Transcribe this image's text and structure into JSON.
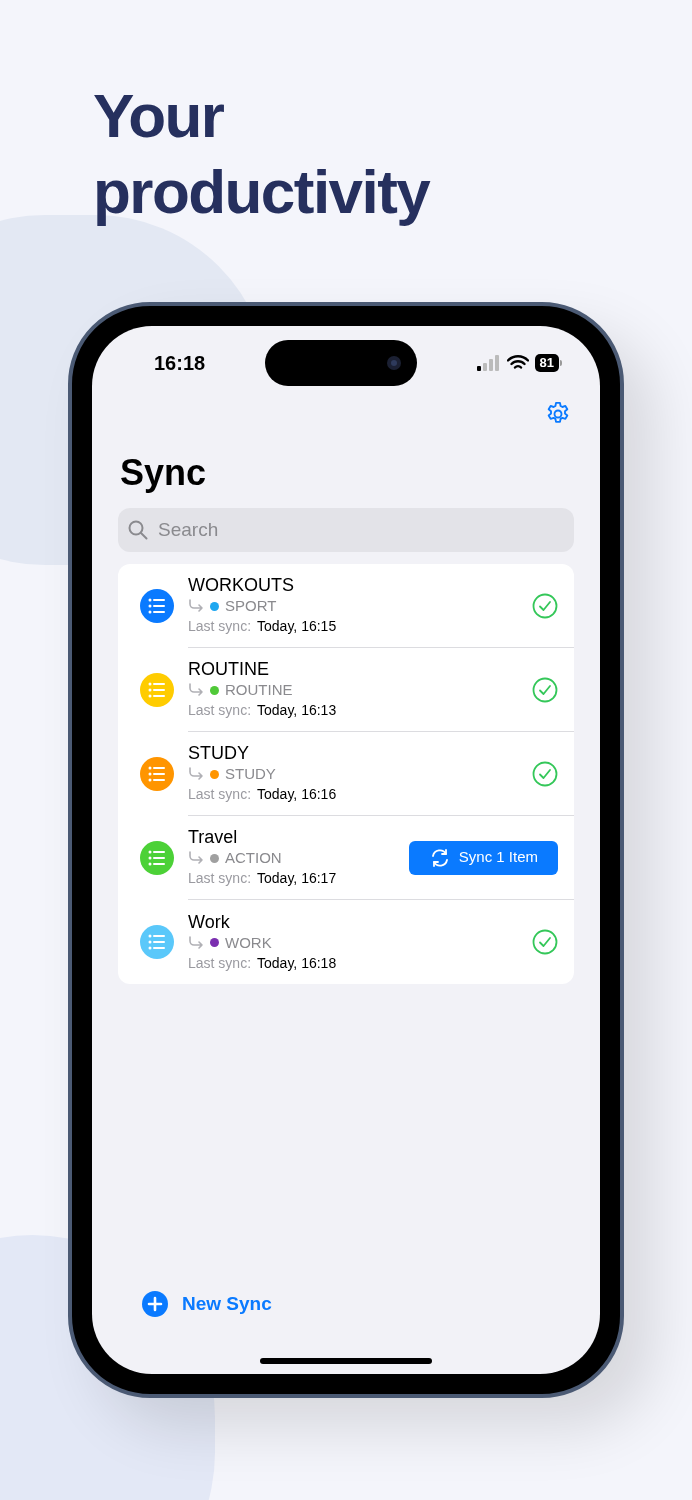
{
  "headline": [
    "Your",
    "productivity"
  ],
  "status_bar": {
    "time": "16:18",
    "battery": "81"
  },
  "title": "Sync",
  "search": {
    "placeholder": "Search"
  },
  "syncs": [
    {
      "name": "WORKOUTS",
      "color": "#0a7aff",
      "tag": {
        "label": "SPORT",
        "color": "#1ea7f0"
      },
      "last_sync_label": "Last sync:",
      "last_sync": "Today, 16:15",
      "status": {
        "kind": "done"
      }
    },
    {
      "name": "ROUTINE",
      "color": "#ffcc00",
      "tag": {
        "label": "ROUTINE",
        "color": "#50c938"
      },
      "last_sync_label": "Last sync:",
      "last_sync": "Today, 16:13",
      "status": {
        "kind": "done"
      }
    },
    {
      "name": "STUDY",
      "color": "#ff9500",
      "tag": {
        "label": "STUDY",
        "color": "#ff9500"
      },
      "last_sync_label": "Last sync:",
      "last_sync": "Today, 16:16",
      "status": {
        "kind": "done"
      }
    },
    {
      "name": "Travel",
      "color": "#4cd137",
      "tag": {
        "label": "ACTION",
        "color": "#a0a0a0"
      },
      "last_sync_label": "Last sync:",
      "last_sync": "Today, 16:17",
      "status": {
        "kind": "pending",
        "label": "Sync 1 Item"
      }
    },
    {
      "name": "Work",
      "color": "#5ac8fa",
      "tag": {
        "label": "WORK",
        "color": "#7b2fb0"
      },
      "last_sync_label": "Last sync:",
      "last_sync": "Today, 16:18",
      "status": {
        "kind": "done"
      }
    }
  ],
  "new_sync": "New Sync"
}
